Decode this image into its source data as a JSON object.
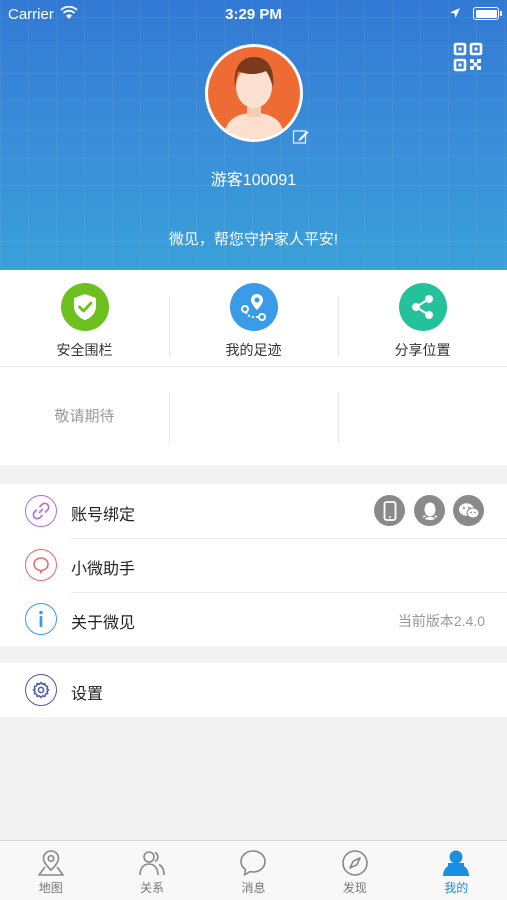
{
  "status_bar": {
    "carrier": "Carrier",
    "time": "3:29 PM"
  },
  "profile": {
    "username": "游客100091",
    "slogan": "微见，帮您守护家人平安!"
  },
  "features": [
    {
      "label": "安全围栏",
      "icon": "shield-check-icon",
      "color": "#6cc11e"
    },
    {
      "label": "我的足迹",
      "icon": "footprint-route-icon",
      "color": "#3a9be8"
    },
    {
      "label": "分享位置",
      "icon": "share-icon",
      "color": "#23c29a"
    }
  ],
  "coming_soon": "敬请期待",
  "menu": {
    "account_binding": {
      "label": "账号绑定",
      "icon": "link-icon",
      "color": "#b46cd8",
      "badges": [
        "phone-icon",
        "qq-icon",
        "wechat-icon"
      ]
    },
    "assistant": {
      "label": "小微助手",
      "icon": "chat-bubble-icon",
      "color": "#e06a6a"
    },
    "about": {
      "label": "关于微见",
      "icon": "info-icon",
      "color": "#3a9be8",
      "value": "当前版本2.4.0"
    },
    "settings": {
      "label": "设置",
      "icon": "gear-icon",
      "color": "#4a5aa8"
    }
  },
  "tabs": [
    {
      "label": "地图",
      "icon": "map-pin-icon",
      "active": false
    },
    {
      "label": "关系",
      "icon": "people-icon",
      "active": false
    },
    {
      "label": "消息",
      "icon": "message-icon",
      "active": false
    },
    {
      "label": "发现",
      "icon": "compass-icon",
      "active": false
    },
    {
      "label": "我的",
      "icon": "user-icon",
      "active": true
    }
  ],
  "colors": {
    "header_blue": "#3279d4",
    "tab_active": "#1a8fe0"
  }
}
